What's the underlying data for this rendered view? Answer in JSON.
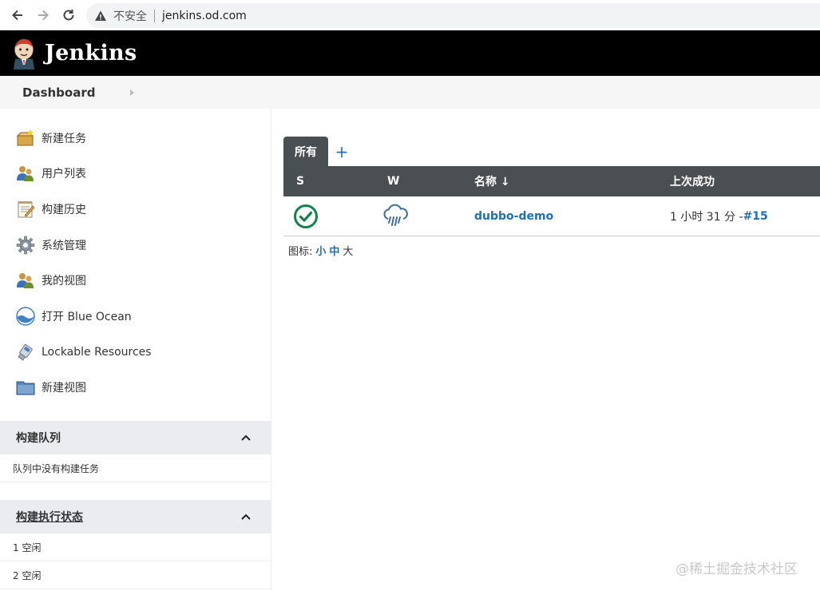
{
  "browser": {
    "insecure_label": "不安全",
    "url": "jenkins.od.com"
  },
  "header": {
    "brand": "Jenkins"
  },
  "breadcrumb": {
    "items": [
      "Dashboard"
    ]
  },
  "sidebar": {
    "tasks": [
      {
        "label": "新建任务",
        "icon": "new-item-icon"
      },
      {
        "label": "用户列表",
        "icon": "people-icon"
      },
      {
        "label": "构建历史",
        "icon": "notepad-icon"
      },
      {
        "label": "系统管理",
        "icon": "gear-icon"
      },
      {
        "label": "我的视图",
        "icon": "user-icon"
      },
      {
        "label": "打开 Blue Ocean",
        "icon": "blue-ocean-icon"
      },
      {
        "label": "Lockable Resources",
        "icon": "usb-icon"
      },
      {
        "label": "新建视图",
        "icon": "folder-icon"
      }
    ],
    "build_queue": {
      "title": "构建队列",
      "empty_text": "队列中没有构建任务"
    },
    "executors": {
      "title": "构建执行状态",
      "rows": [
        "1  空闲",
        "2  空闲"
      ]
    }
  },
  "main": {
    "tabs": [
      {
        "label": "所有"
      }
    ],
    "add_tab_label": "+",
    "table": {
      "columns": [
        "S",
        "W",
        "名称 ↓",
        "上次成功"
      ],
      "rows": [
        {
          "status": "success",
          "weather": "rain",
          "name": "dubbo-demo",
          "last_success_time": "1 小时 31 分 - ",
          "last_success_build": "#15"
        }
      ]
    },
    "legend": {
      "label": "图标:",
      "sizes": [
        "小",
        "中",
        "大"
      ]
    }
  },
  "watermark": "@稀土掘金技术社区",
  "colors": {
    "header_bg": "#000000",
    "table_header_bg": "#4a4f54",
    "link": "#206fb2",
    "success": "#138347"
  }
}
